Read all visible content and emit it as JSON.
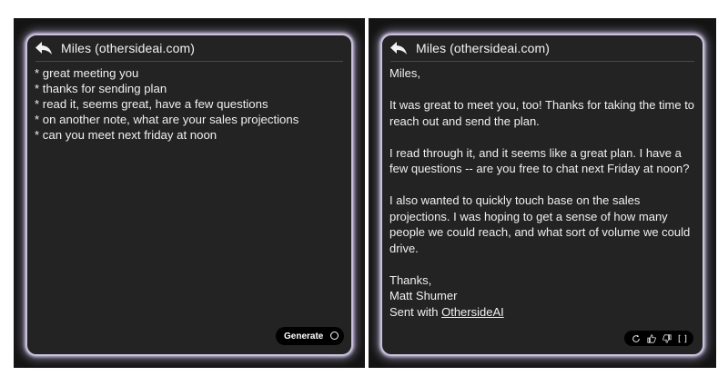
{
  "left": {
    "recipient": "Miles (othersideai.com)",
    "notes": [
      "* great meeting you",
      "* thanks for sending plan",
      "* read it, seems great, have a few questions",
      "* on another note, what are your sales projections",
      "* can you meet next friday at noon"
    ],
    "generate_label": "Generate",
    "icons": [
      "reply-icon",
      "loading-spinner-icon"
    ]
  },
  "right": {
    "recipient": "Miles (othersideai.com)",
    "greeting": "Miles,",
    "paragraphs": [
      "It was great to meet you, too! Thanks for taking the time to reach out and send the plan.",
      "I read through it, and it seems like a great plan. I have a few questions -- are you free to chat next Friday at noon?",
      "I also wanted to quickly touch base on the sales projections. I was hoping to get a sense of how many people we could reach, and what sort of volume we could drive."
    ],
    "signoff": "Thanks,",
    "name": "Matt Shumer",
    "sent_with_prefix": "Sent with ",
    "brand": "OthersideAI",
    "icons": [
      "reply-icon",
      "regenerate-icon",
      "thumbs-up-icon",
      "thumbs-down-icon",
      "copy-icon"
    ]
  },
  "colors": {
    "card_bg": "#232323",
    "card_border": "#c8c0de",
    "text": "#f0f0f0",
    "button_bg": "#000000"
  }
}
